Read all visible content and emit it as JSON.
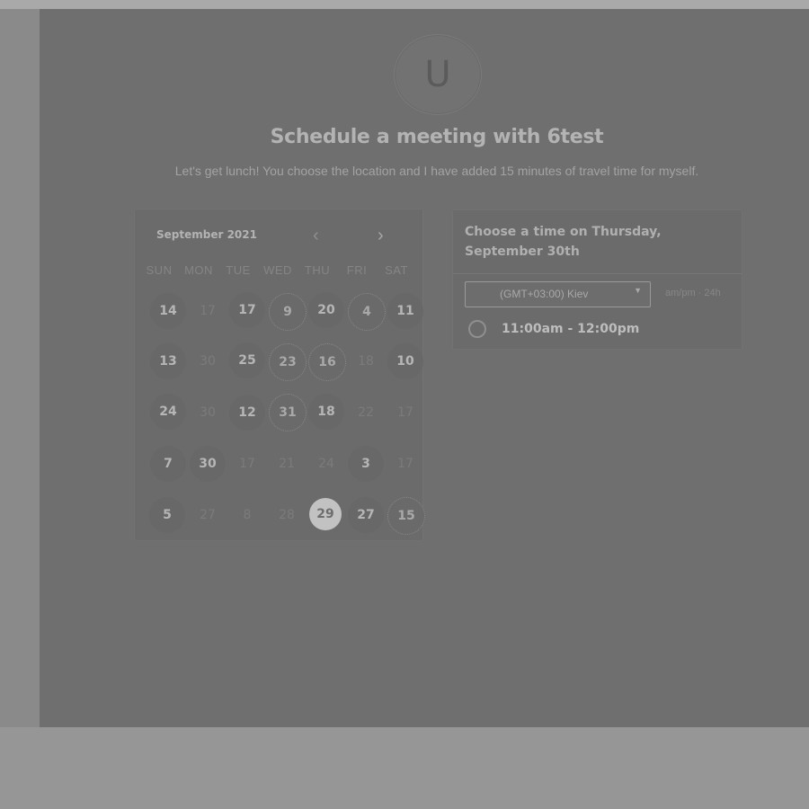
{
  "avatar": {
    "initial": "U"
  },
  "page": {
    "title": "Schedule a meeting with 6test",
    "subtitle": "Let's get lunch! You choose the location and I have added 15 minutes of travel time for myself."
  },
  "calendar": {
    "month": "September 2021",
    "prev_icon": "‹",
    "next_icon": "›",
    "weekdays": [
      "SUN",
      "MON",
      "TUE",
      "WED",
      "THU",
      "FRI",
      "SAT"
    ],
    "weeks": [
      [
        "14",
        "17",
        "17",
        "9",
        "20",
        "4",
        "11"
      ],
      [
        "13",
        "30",
        "25",
        "23",
        "16",
        "18",
        "10"
      ],
      [
        "24",
        "30",
        "12",
        "31",
        "18",
        "22",
        "17"
      ],
      [
        "7",
        "30",
        "17",
        "21",
        "24",
        "3",
        "17"
      ],
      [
        "5",
        "27",
        "8",
        "28",
        "29",
        "27",
        "15"
      ]
    ]
  },
  "time_panel": {
    "heading": "Choose a time on Thursday, September 30th",
    "timezone": "(GMT+03:00) Kiev",
    "dropdown_icon": "▼",
    "hour_format": "am/pm · 24h",
    "slots": [
      "11:00am - 12:00pm"
    ]
  }
}
